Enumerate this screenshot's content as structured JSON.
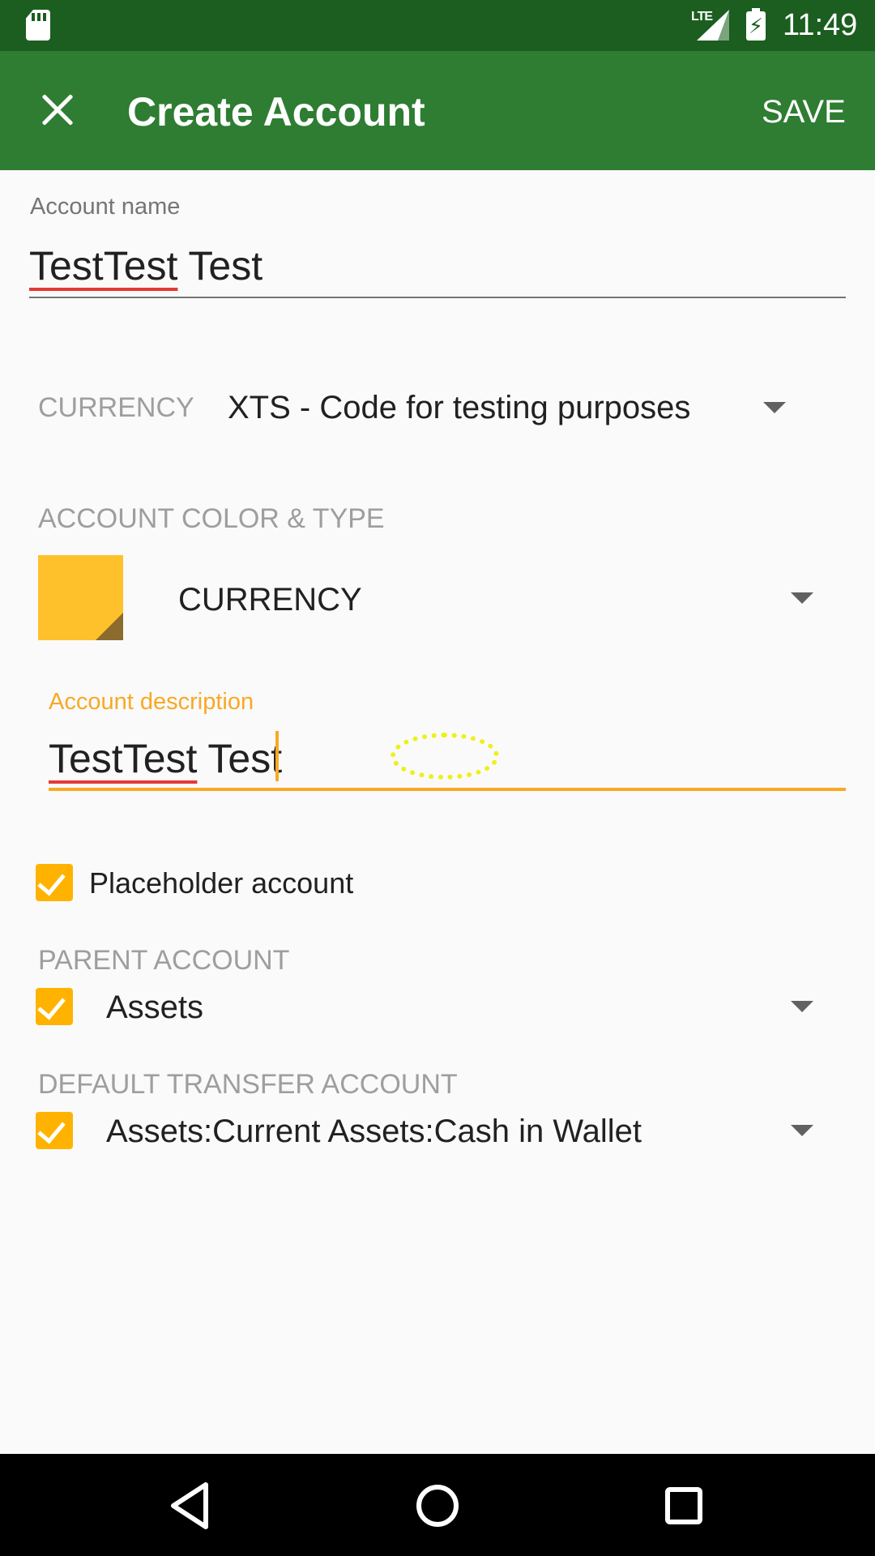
{
  "status_bar": {
    "network": "LTE",
    "time": "11:49"
  },
  "app_bar": {
    "title": "Create Account",
    "save_label": "SAVE"
  },
  "form": {
    "account_name": {
      "label": "Account name",
      "value_misspelled": "TestTest",
      "value_rest": " Test"
    },
    "currency": {
      "label": "CURRENCY",
      "value": "XTS - Code for testing purposes"
    },
    "color_type": {
      "label": "ACCOUNT COLOR & TYPE",
      "swatch_color": "#FFC12B",
      "type_value": "CURRENCY"
    },
    "description": {
      "label": "Account description",
      "value_misspelled": "TestTest",
      "value_rest": " Test",
      "accent_color": "#F9A825"
    },
    "placeholder": {
      "label": "Placeholder account",
      "checked": true
    },
    "parent_account": {
      "label": "PARENT ACCOUNT",
      "value": "Assets",
      "checked": true
    },
    "default_transfer": {
      "label": "DEFAULT TRANSFER ACCOUNT",
      "value": "Assets:Current Assets:Cash in Wallet",
      "checked": true
    }
  },
  "nav_bar": {
    "icons": [
      "back-icon",
      "home-icon",
      "recents-icon"
    ]
  },
  "colors": {
    "status_bar": "#1B5E20",
    "app_bar": "#2E7D32",
    "checkbox": "#FFB300"
  }
}
